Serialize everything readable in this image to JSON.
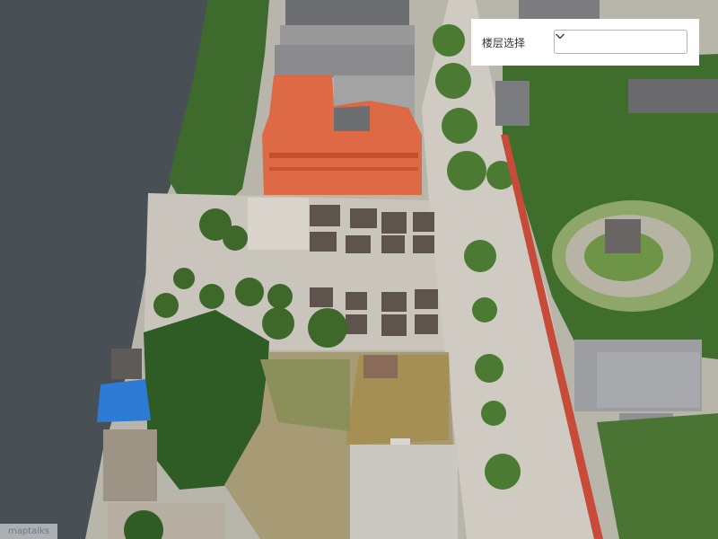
{
  "floor_panel": {
    "label": "楼层选择",
    "selected": ""
  },
  "attribution": {
    "text": "maptalks"
  },
  "map": {
    "highlight_color": "#e0643c"
  }
}
